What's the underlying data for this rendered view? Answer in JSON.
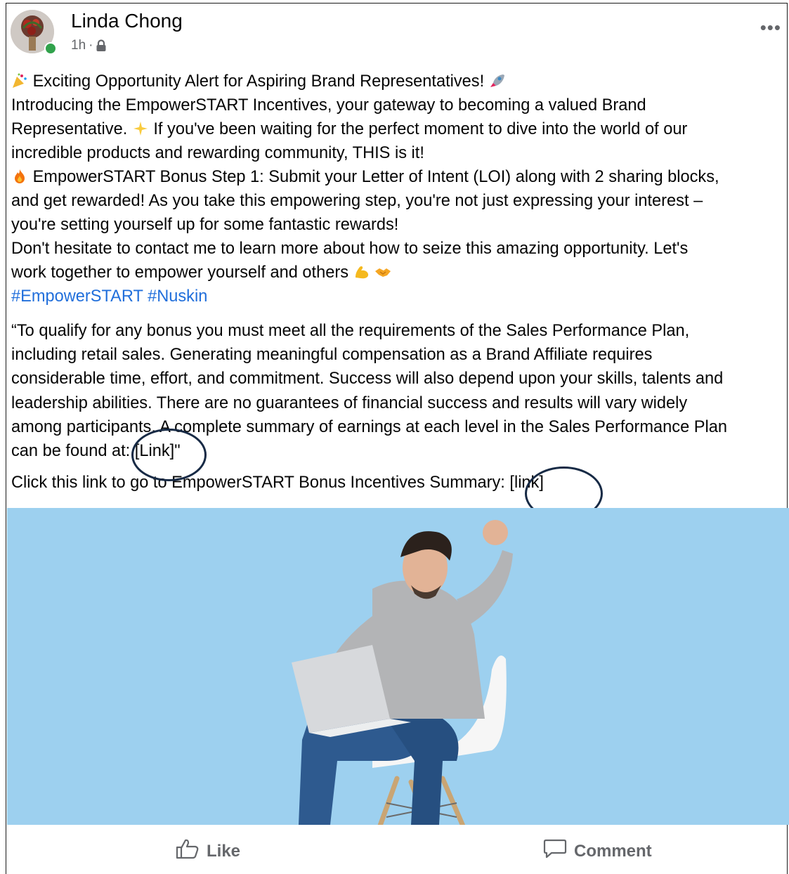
{
  "post": {
    "author": "Linda Chong",
    "time": "1h",
    "separator": "·",
    "privacy_icon": "lock-icon",
    "more_icon": "more-options-icon",
    "more_label": "•••",
    "paragraphs": {
      "line1": "Exciting Opportunity Alert for Aspiring Brand Representatives!",
      "line2a": "Introducing the EmpowerSTART Incentives, your gateway to becoming a valued Brand",
      "line2b": "Representative.",
      "line2c": "If you've been waiting for the perfect moment to dive into the world of our",
      "line2d": "incredible products and rewarding community, THIS is it!",
      "line3a": "EmpowerSTART Bonus Step 1: Submit your Letter of Intent (LOI) along with 2 sharing blocks,",
      "line3b": "and get rewarded! As you take this empowering step, you're not just expressing your interest –",
      "line3c": "you're setting yourself up for some fantastic rewards!",
      "line4a": "Don't hesitate to contact me to learn more about how to seize this amazing opportunity. Let's",
      "line4b": "work together to empower yourself and others"
    },
    "hashtags": [
      "#EmpowerSTART",
      "#Nuskin"
    ],
    "disclaimer": {
      "l1": "“To qualify for any bonus you must meet all the requirements of the Sales Performance Plan,",
      "l2": "including retail sales. Generating meaningful compensation as a Brand Affiliate requires",
      "l3": "considerable time, effort, and commitment. Success will also depend upon your skills, talents and",
      "l4": "leadership abilities. There are no guarantees of financial success and results will vary widely",
      "l5": "among participants. A complete summary of earnings at each level in the Sales Performance Plan",
      "l6_prefix": "can be found at: ",
      "l6_link": "[Link]",
      "l6_suffix": "\""
    },
    "click_line": {
      "prefix": "Click this link to go to EmpowerSTART Bonus Incentives Summary: ",
      "link": "[link]"
    },
    "emoji_icons": [
      "party-popper-icon",
      "rocket-icon",
      "sparkles-icon",
      "fire-icon",
      "flexed-biceps-icon",
      "handshake-icon"
    ]
  },
  "actions": {
    "like_label": "Like",
    "comment_label": "Comment"
  },
  "colors": {
    "hashtag": "#216fdb",
    "meta_gray": "#65676b",
    "online": "#31a24c",
    "photo_bg": "#9dd0ef",
    "annotation_circle": "#172a45"
  }
}
